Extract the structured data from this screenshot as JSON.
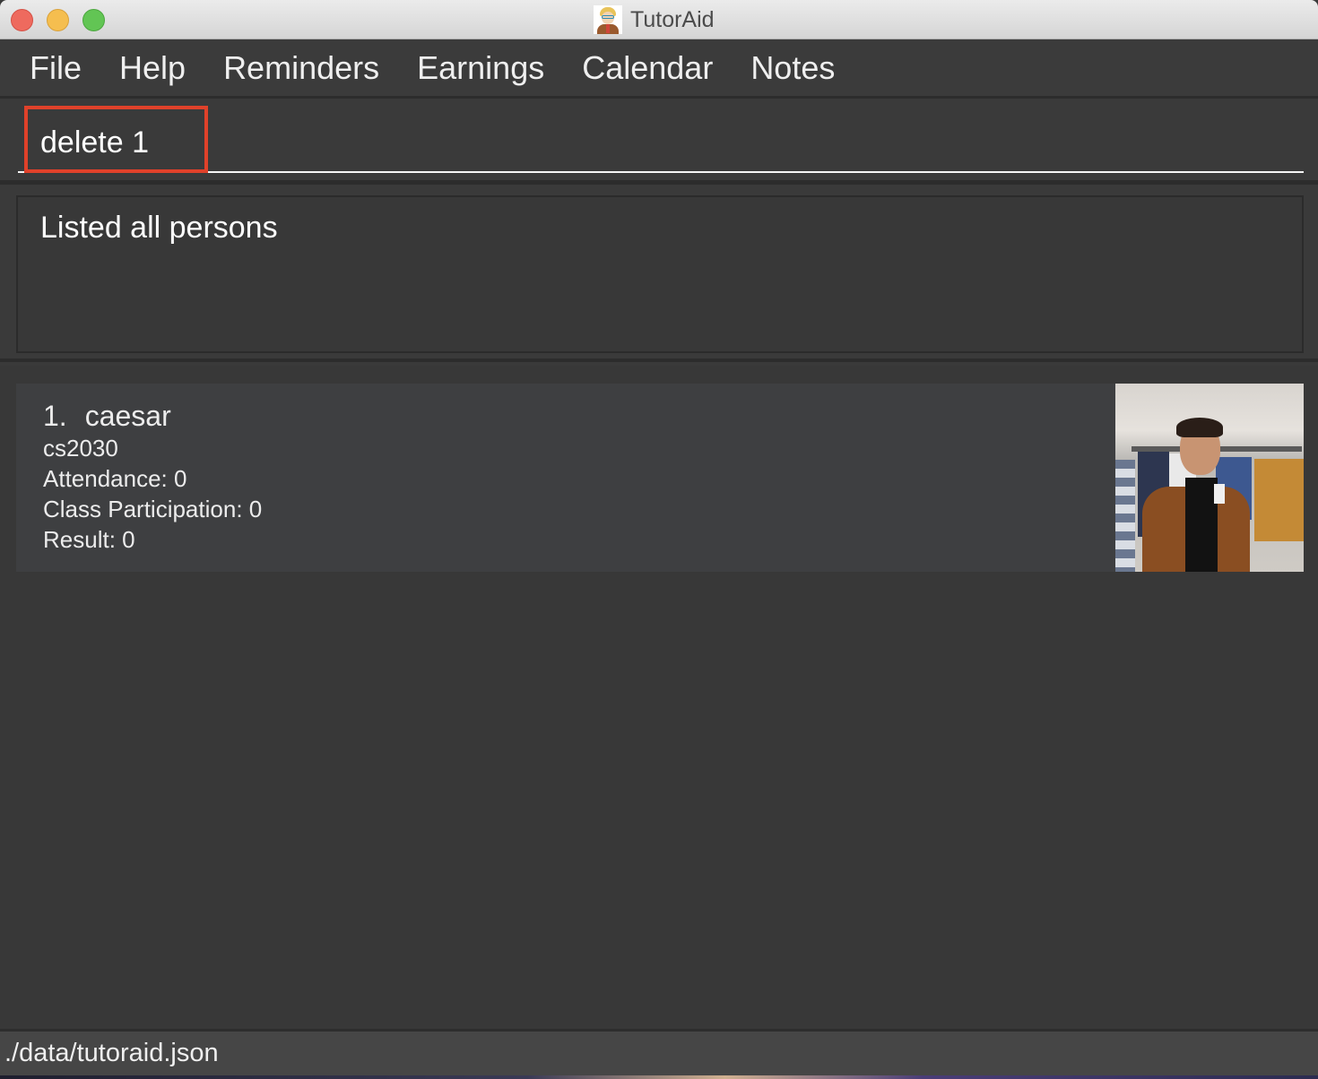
{
  "window": {
    "title": "TutorAid",
    "app_icon": "tutor-avatar-icon",
    "controls": [
      "close",
      "minimize",
      "maximize"
    ]
  },
  "menubar": {
    "items": [
      {
        "label": "File"
      },
      {
        "label": "Help"
      },
      {
        "label": "Reminders"
      },
      {
        "label": "Earnings"
      },
      {
        "label": "Calendar"
      },
      {
        "label": "Notes"
      }
    ]
  },
  "command": {
    "value": "delete 1",
    "highlight_color": "#e0412a"
  },
  "result": {
    "message": "Listed all persons"
  },
  "persons": [
    {
      "index": "1.",
      "name": "caesar",
      "module": "cs2030",
      "attendance": "Attendance: 0",
      "participation": "Class Participation: 0",
      "result": "Result: 0",
      "photo": "student-photo"
    }
  ],
  "status": {
    "file_path": "./data/tutoraid.json"
  }
}
